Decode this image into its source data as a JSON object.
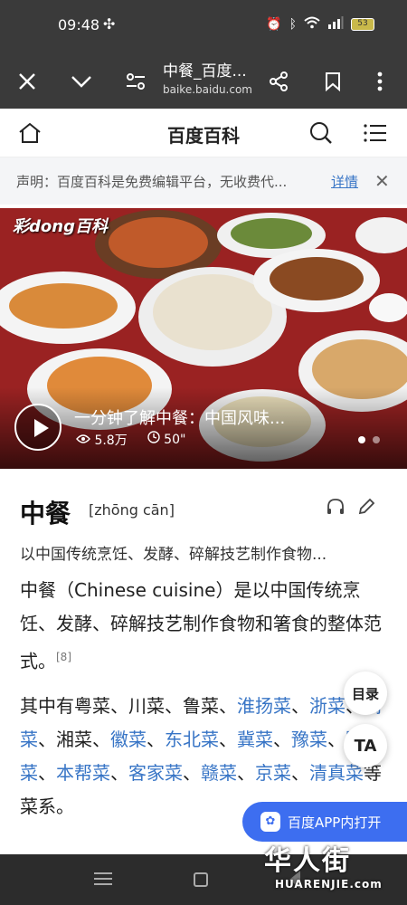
{
  "status": {
    "time": "09:48",
    "battery": "53",
    "fan_icon": "fan-icon"
  },
  "browser": {
    "title": "中餐_百度...",
    "url": "baike.baidu.com"
  },
  "site": {
    "logo_text": "百度百科"
  },
  "notice": {
    "text": "声明：百度百科是免费编辑平台，无收费代...",
    "link": "详情"
  },
  "hero": {
    "brand": "彩dong百科",
    "video_title": "一分钟了解中餐：中国风味...",
    "views": "5.8万",
    "duration": "50\""
  },
  "article": {
    "headword": "中餐",
    "pinyin": "[zhōng cān]",
    "summary": "以中国传统烹饪、发酵、碎解技艺制作食物...",
    "para1": "中餐（Chinese cuisine）是以中国传统烹饪、发酵、碎解技艺制作食物和箸食的整体范式。",
    "ref": "[8]",
    "para2_intro": "其中有粤菜、川菜、鲁菜、",
    "cuisines": {
      "c1": "淮扬菜",
      "c2": "浙菜",
      "c3": "闽菜",
      "c4": "湘菜",
      "c5": "徽菜",
      "c6": "东北菜",
      "c7": "冀菜",
      "c8": "豫菜",
      "c9": "鄂菜",
      "c10": "本帮菜",
      "c11": "客家菜",
      "c12": "赣菜",
      "c13": "京菜",
      "c14": "清真菜"
    },
    "sep": "、",
    "ending": "等菜系。"
  },
  "floating": {
    "toc": "目录",
    "ta": "TA",
    "open_app": "百度APP内打开"
  },
  "watermark": {
    "cn": "华人街",
    "en": "HUARENJIE.com"
  },
  "colors": {
    "link": "#3875c6",
    "app_button": "#3d6ef0",
    "chrome_bg": "#3a3a3a"
  }
}
